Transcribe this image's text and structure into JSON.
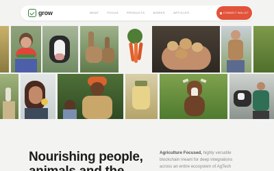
{
  "brand": {
    "name": "grow",
    "accent": "#e2533b",
    "logo_color": "#2f7d3a"
  },
  "nav": {
    "items": [
      "WHAT",
      "FOCUS",
      "PRODUCTS",
      "WORKS",
      "ARTICLES"
    ],
    "cta_label": "CONNECT WALLET"
  },
  "gallery": {
    "description": "collage of farm, food and people photos"
  },
  "hero": {
    "headline_line1": "Nourishing people,",
    "headline_line2": "animals and the",
    "intro_emphasis": "Agriculture Focused,",
    "intro_line1_rest": " highly versatile",
    "intro_line2": "blockchain meant for deep integrations",
    "intro_line3": "across an entire ecosystem of AgTech"
  }
}
